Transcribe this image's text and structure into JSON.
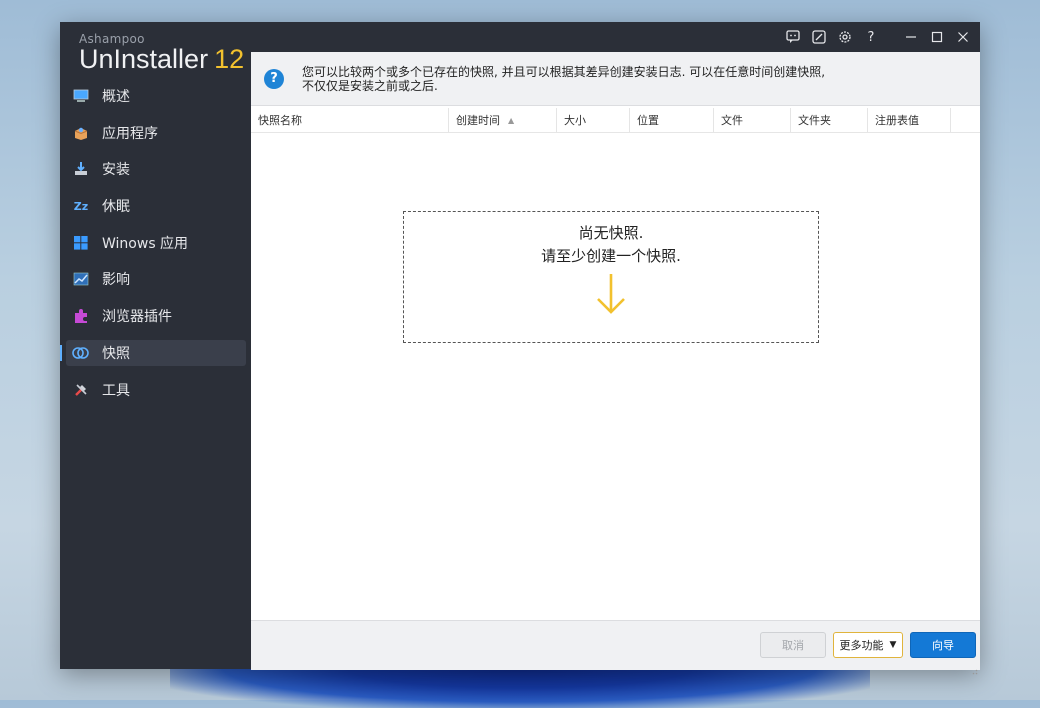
{
  "app": {
    "brand_small": "Ashampoo",
    "brand_name": "UnInstaller",
    "brand_version": "12"
  },
  "sidebar": {
    "items": [
      {
        "label": "概述",
        "icon": "monitor-icon"
      },
      {
        "label": "应用程序",
        "icon": "package-icon"
      },
      {
        "label": "安装",
        "icon": "install-icon"
      },
      {
        "label": "休眠",
        "icon": "sleep-icon"
      },
      {
        "label": "Winows 应用",
        "icon": "windows-icon"
      },
      {
        "label": "影响",
        "icon": "chart-icon"
      },
      {
        "label": "浏览器插件",
        "icon": "puzzle-icon"
      },
      {
        "label": "快照",
        "icon": "snapshot-icon",
        "active": true
      },
      {
        "label": "工具",
        "icon": "tools-icon"
      }
    ]
  },
  "titlebar": {
    "icons": [
      "feedback-icon",
      "edit-icon",
      "settings-icon",
      "help-icon",
      "minimize-icon",
      "maximize-icon",
      "close-icon"
    ]
  },
  "info": {
    "line1": "您可以比较两个或多个已存在的快照, 并且可以根据其差异创建安装日志. 可以在任意时间创建快照,",
    "line2": "不仅仅是安装之前或之后."
  },
  "table": {
    "columns": [
      "快照名称",
      "创建时间",
      "大小",
      "位置",
      "文件",
      "文件夹",
      "注册表值"
    ],
    "sorted_column": "创建时间"
  },
  "empty_state": {
    "line1": "尚无快照.",
    "line2": "请至少创建一个快照."
  },
  "footer": {
    "cancel_label": "取消",
    "more_label": "更多功能",
    "wizard_label": "向导"
  },
  "colors": {
    "sidebar_bg": "#2b2f38",
    "accent_blue": "#1479d6",
    "accent_yellow": "#f2c12e"
  }
}
